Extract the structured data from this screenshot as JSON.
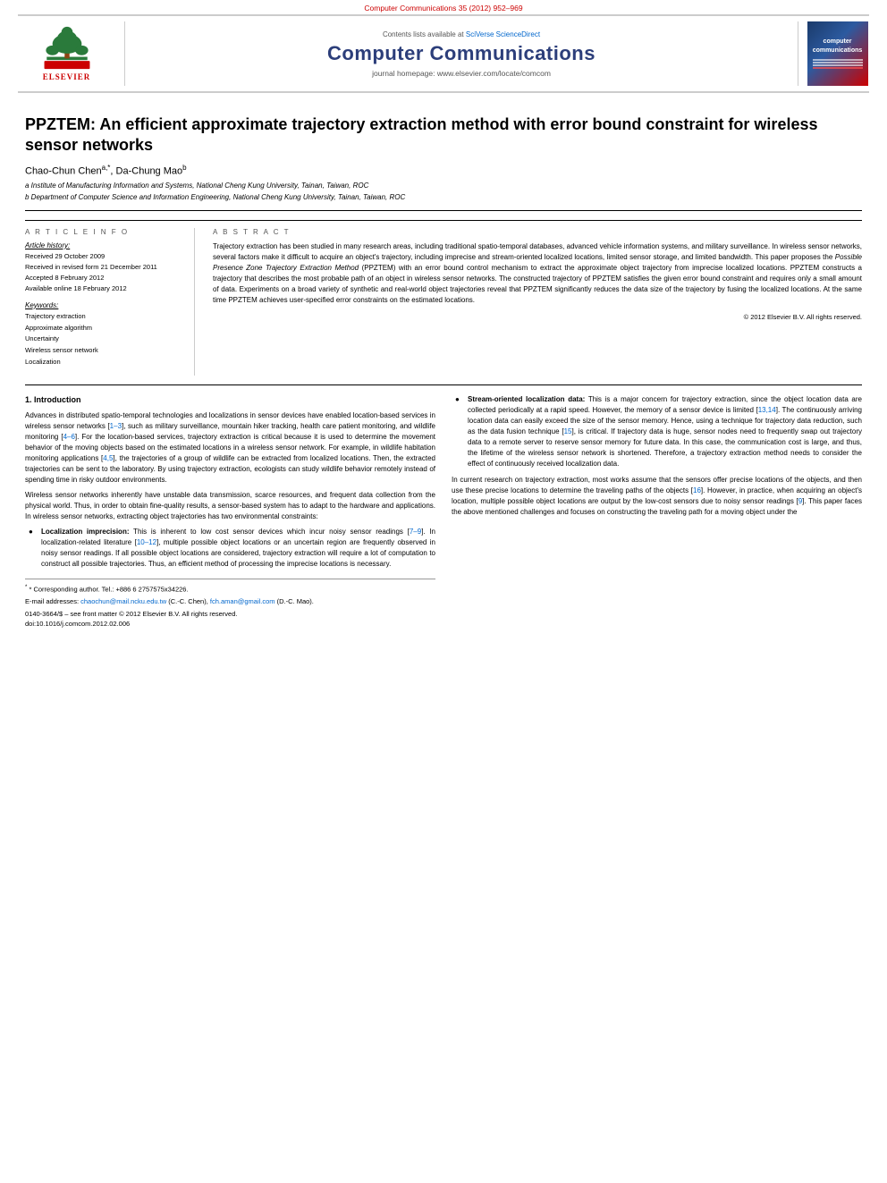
{
  "top_bar": {
    "journal_ref": "Computer Communications 35 (2012) 952–969"
  },
  "journal_header": {
    "sciverse_text": "Contents lists available at",
    "sciverse_link": "SciVerse ScienceDirect",
    "title": "Computer Communications",
    "homepage_label": "journal homepage: www.elsevier.com/locate/comcom",
    "cover_text": "computer\ncommunications"
  },
  "elsevier": {
    "text": "ELSEVIER"
  },
  "article": {
    "title": "PPZTEM: An efficient approximate trajectory extraction method with error bound constraint for wireless sensor networks",
    "authors": "Chao-Chun Chen",
    "author_a_sup": "a,*",
    "author2": ", Da-Chung Mao",
    "author_b_sup": "b",
    "affil_a": "a Institute of Manufacturing Information and Systems, National Cheng Kung University, Tainan, Taiwan, ROC",
    "affil_b": "b Department of Computer Science and Information Engineering, National Cheng Kung University, Tainan, Taiwan, ROC"
  },
  "article_info": {
    "section_label": "A R T I C L E   I N F O",
    "history_label": "Article history:",
    "received_1": "Received 29 October 2009",
    "received_2": "Received in revised form 21 December 2011",
    "accepted": "Accepted 8 February 2012",
    "available": "Available online 18 February 2012",
    "keywords_label": "Keywords:",
    "keyword1": "Trajectory extraction",
    "keyword2": "Approximate algorithm",
    "keyword3": "Uncertainty",
    "keyword4": "Wireless sensor network",
    "keyword5": "Localization"
  },
  "abstract": {
    "section_label": "A B S T R A C T",
    "text": "Trajectory extraction has been studied in many research areas, including traditional spatio-temporal databases, advanced vehicle information systems, and military surveillance. In wireless sensor networks, several factors make it difficult to acquire an object's trajectory, including imprecise and stream-oriented localized locations, limited sensor storage, and limited bandwidth. This paper proposes the Possible Presence Zone Trajectory Extraction Method (PPZTEM) with an error bound control mechanism to extract the approximate object trajectory from imprecise localized locations. PPZTEM constructs a trajectory that describes the most probable path of an object in wireless sensor networks. The constructed trajectory of PPZTEM satisfies the given error bound constraint and requires only a small amount of data. Experiments on a broad variety of synthetic and real-world object trajectories reveal that PPZTEM significantly reduces the data size of the trajectory by fusing the localized locations. At the same time PPZTEM achieves user-specified error constraints on the estimated locations.",
    "copyright": "© 2012 Elsevier B.V. All rights reserved."
  },
  "section1": {
    "heading": "1. Introduction",
    "para1": "Advances in distributed spatio-temporal technologies and localizations in sensor devices have enabled location-based services in wireless sensor networks [1–3], such as military surveillance, mountain hiker tracking, health care patient monitoring, and wildlife monitoring [4–6]. For the location-based services, trajectory extraction is critical because it is used to determine the movement behavior of the moving objects based on the estimated locations in a wireless sensor network. For example, in wildlife habitation monitoring applications [4,5], the trajectories of a group of wildlife can be extracted from localized locations. Then, the extracted trajectories can be sent to the laboratory. By using trajectory extraction, ecologists can study wildlife behavior remotely instead of spending time in risky outdoor environments.",
    "para2": "Wireless sensor networks inherently have unstable data transmission, scarce resources, and frequent data collection from the physical world. Thus, in order to obtain fine-quality results, a sensor-based system has to adapt to the hardware and applications. In wireless sensor networks, extracting object trajectories has two environmental constraints:",
    "bullet1_term": "Localization imprecision:",
    "bullet1_text": " This is inherent to low cost sensor devices which incur noisy sensor readings [7–9]. In localization-related literature [10–12], multiple possible object locations or an uncertain region are frequently observed in noisy sensor readings. If all possible object locations are considered, trajectory extraction will require a lot of computation to construct all possible trajectories. Thus, an efficient method of processing the imprecise locations is necessary.",
    "bullet2_term": "Stream-oriented localization data:",
    "bullet2_text": " This is a major concern for trajectory extraction, since the object location data are collected periodically at a rapid speed. However, the memory of a sensor device is limited [13,14]. The continuously arriving location data can easily exceed the size of the sensor memory. Hence, using a technique for trajectory data reduction, such as the data fusion technique [15], is critical. If trajectory data is huge, sensor nodes need to frequently swap out trajectory data to a remote server to reserve sensor memory for future data. In this case, the communication cost is large, and thus, the lifetime of the wireless sensor network is shortened. Therefore, a trajectory extraction method needs to consider the effect of continuously received localization data.",
    "para3": "In current research on trajectory extraction, most works assume that the sensors offer precise locations of the objects, and then use these precise locations to determine the traveling paths of the objects [16]. However, in practice, when acquiring an object's location, multiple possible object locations are output by the low-cost sensors due to noisy sensor readings [9]. This paper faces the above mentioned challenges and focuses on constructing the traveling path for a moving object under the"
  },
  "footer": {
    "corresponding": "* Corresponding author. Tel.: +886 6 2757575x34226.",
    "email_label": "E-mail addresses:",
    "email1": "chaochun@mail.ncku.edu.tw",
    "email1_name": " (C.-C. Chen),",
    "email2": "fch.aman@gmail.com",
    "email2_name": " (D.-C. Mao).",
    "copyright_footer": "0140-3664/$ – see front matter © 2012 Elsevier B.V. All rights reserved.",
    "doi": "doi:10.1016/j.comcom.2012.02.006"
  }
}
